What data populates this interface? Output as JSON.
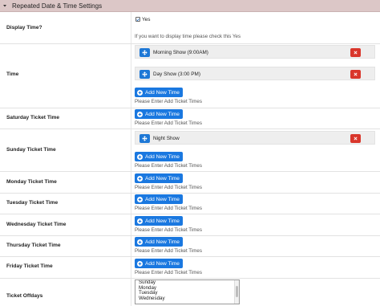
{
  "panel": {
    "title": "Repeated Date & Time Settings"
  },
  "display_time": {
    "label": "Display Time?",
    "checkbox_label": "Yes",
    "hint": "If you want to display time please check this Yes"
  },
  "time": {
    "label": "Time",
    "entries": [
      "Morning Show (9:00AM)",
      "Day Show (3:00 PM)"
    ],
    "add_label": "Add New Time",
    "hint": "Please Enter Add Ticket Times"
  },
  "days": [
    {
      "label": "Saturday Ticket Time",
      "add_label": "Add New Time",
      "hint": "Please Enter Add Ticket Times"
    },
    {
      "label": "Sunday Ticket Time",
      "entry": "Night Show",
      "add_label": "Add New Time",
      "hint": "Please Enter Add Ticket Times"
    },
    {
      "label": "Monday Ticket Time",
      "add_label": "Add New Time",
      "hint": "Please Enter Add Ticket Times"
    },
    {
      "label": "Tuesday Ticket Time",
      "add_label": "Add New Time",
      "hint": "Please Enter Add Ticket Times"
    },
    {
      "label": "Wednesday Ticket Time",
      "add_label": "Add New Time",
      "hint": "Please Enter Add Ticket Times"
    },
    {
      "label": "Thursday Ticket Time",
      "add_label": "Add New Time",
      "hint": "Please Enter Add Ticket Times"
    },
    {
      "label": "Friday Ticket Time",
      "add_label": "Add New Time",
      "hint": "Please Enter Add Ticket Times"
    }
  ],
  "offdays": {
    "label": "Ticket Offdays",
    "options": [
      "Sunday",
      "Monday",
      "Tuesday",
      "Wednesday"
    ]
  },
  "colors": {
    "header_bg": "#dcc7c7",
    "primary": "#1a78e0",
    "danger": "#d9362b",
    "entry_bg": "#eeeeee"
  }
}
